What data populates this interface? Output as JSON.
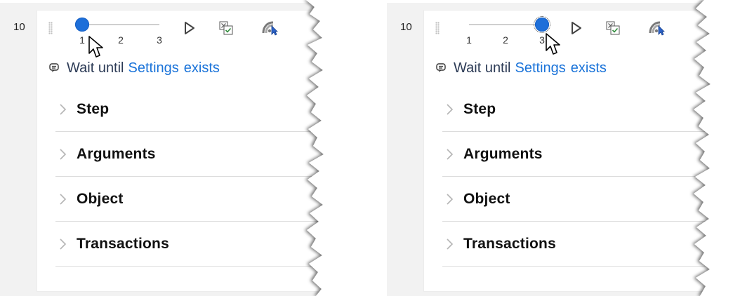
{
  "panels": [
    {
      "step_number": "10",
      "slider": {
        "ticks": [
          "1",
          "2",
          "3"
        ],
        "selected_value": 1,
        "focused": false
      },
      "step_text": {
        "action": "Wait until",
        "object": "Settings",
        "condition": "exists"
      },
      "sections": [
        {
          "label": "Step"
        },
        {
          "label": "Arguments"
        },
        {
          "label": "Object"
        },
        {
          "label": "Transactions"
        }
      ]
    },
    {
      "step_number": "10",
      "slider": {
        "ticks": [
          "1",
          "2",
          "3"
        ],
        "selected_value": 3,
        "focused": true
      },
      "step_text": {
        "action": "Wait until",
        "object": "Settings",
        "condition": "exists"
      },
      "sections": [
        {
          "label": "Step"
        },
        {
          "label": "Arguments"
        },
        {
          "label": "Object"
        },
        {
          "label": "Transactions"
        }
      ]
    }
  ],
  "icons": [
    "play-icon",
    "checkpoint-icon",
    "object-spy-icon",
    "comment-icon",
    "chevron-right-icon",
    "mouse-cursor-icon"
  ],
  "colors": {
    "accent": "#1e6fd9",
    "link": "#1a73d9",
    "text": "#2b3a55"
  }
}
